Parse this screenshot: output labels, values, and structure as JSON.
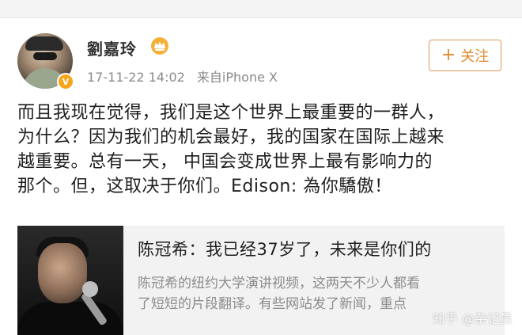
{
  "post": {
    "author": {
      "name": "劉嘉玲",
      "avatar_icon": "avatar",
      "verified_icon": "verified-v-badge-icon",
      "level_icon": "crown-icon"
    },
    "timestamp": "17-11-22 14:02",
    "source": "来自iPhone X",
    "follow_button": {
      "icon": "+",
      "label": "关注"
    },
    "content_lines": [
      "而且我现在觉得，我们是这个世界上最重要的一群人，",
      "为什么？因为我们的机会最好，我的国家在国际上越来",
      "越重要。总有一天， 中国会变成世界上最有影响力的",
      "那个。但，这取决于你们。Edison: 為你驕傲！"
    ]
  },
  "card": {
    "title": "陈冠希：我已经37岁了，未来是你们的",
    "desc_lines": [
      "陈冠希的纽约大学演讲视频，这两天不少人都看",
      "了短短的片段翻译。有些网站发了新闻，重点"
    ]
  },
  "watermark": "知乎 @杂记员",
  "colors": {
    "follow_accent": "#e08a2e",
    "verified_badge": "#f7a51a",
    "meta_text": "#8a8a8a",
    "card_bg": "#f2f2f2"
  }
}
